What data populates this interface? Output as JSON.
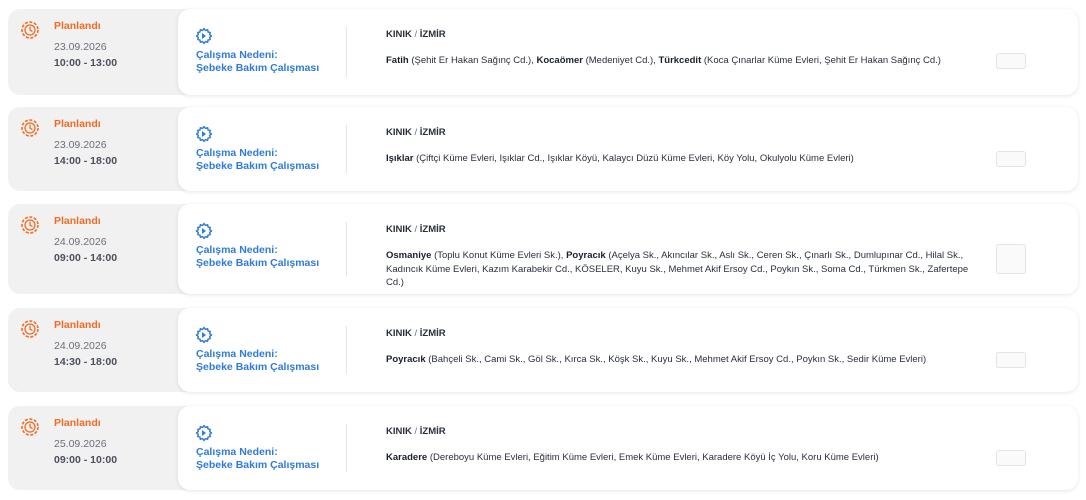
{
  "outages": [
    {
      "status": "Planlandı",
      "date": "23.09.2026",
      "time": "10:00 - 13:00",
      "reason_title": "Çalışma Nedeni:",
      "reason_value": "Şebeke Bakım Çalışması",
      "district": "KINIK",
      "separator": "/",
      "city": "İZMİR",
      "streets": [
        {
          "name": "Fatih",
          "detail": "(Şehit Er Hakan Sağınç Cd.)",
          "sep": ", "
        },
        {
          "name": "Kocaömer",
          "detail": "(Medeniyet Cd.)",
          "sep": ", "
        },
        {
          "name": "Türkcedit",
          "detail": "(Koca Çınarlar Küme Evleri, Şehit Er Hakan Sağınç Cd.)",
          "sep": ""
        }
      ]
    },
    {
      "status": "Planlandı",
      "date": "23.09.2026",
      "time": "14:00 - 18:00",
      "reason_title": "Çalışma Nedeni:",
      "reason_value": "Şebeke Bakım Çalışması",
      "district": "KINIK",
      "separator": "/",
      "city": "İZMİR",
      "streets": [
        {
          "name": "Işıklar",
          "detail": "(Çiftçi Küme Evleri, Işıklar Cd., Işıklar Köyü, Kalaycı Düzü Küme Evleri, Köy Yolu, Okulyolu Küme Evleri)",
          "sep": ""
        }
      ]
    },
    {
      "status": "Planlandı",
      "date": "24.09.2026",
      "time": "09:00 - 14:00",
      "reason_title": "Çalışma Nedeni:",
      "reason_value": "Şebeke Bakım Çalışması",
      "district": "KINIK",
      "separator": "/",
      "city": "İZMİR",
      "streets": [
        {
          "name": "Osmaniye",
          "detail": "(Toplu Konut Küme Evleri Sk.)",
          "sep": ", "
        },
        {
          "name": "Poyracık",
          "detail": "(Açelya Sk., Akıncılar Sk., Aslı Sk., Ceren Sk., Çınarlı Sk., Dumlupınar Cd., Hilal Sk., Kadıncık Küme Evleri, Kazım Karabekir Cd., KÖSELER, Kuyu Sk., Mehmet Akif Ersoy Cd., Poykın Sk., Soma Cd., Türkmen Sk., Zafertepe Cd.)",
          "sep": ""
        }
      ]
    },
    {
      "status": "Planlandı",
      "date": "24.09.2026",
      "time": "14:30 - 18:00",
      "reason_title": "Çalışma Nedeni:",
      "reason_value": "Şebeke Bakım Çalışması",
      "district": "KINIK",
      "separator": "/",
      "city": "İZMİR",
      "streets": [
        {
          "name": "Poyracık",
          "detail": "(Bahçeli Sk., Cami Sk., Göl Sk., Kırca Sk., Köşk Sk., Kuyu Sk., Mehmet Akif Ersoy Cd., Poykın Sk., Sedir Küme Evleri)",
          "sep": ""
        }
      ]
    },
    {
      "status": "Planlandı",
      "date": "25.09.2026",
      "time": "09:00 - 10:00",
      "reason_title": "Çalışma Nedeni:",
      "reason_value": "Şebeke Bakım Çalışması",
      "district": "KINIK",
      "separator": "/",
      "city": "İZMİR",
      "streets": [
        {
          "name": "Karadere",
          "detail": "(Dereboyu Küme Evleri, Eğitim Küme Evleri, Emek Küme Evleri, Karadere Köyü İç Yolu, Koru Küme Evleri)",
          "sep": ""
        }
      ]
    }
  ],
  "icons": {
    "status": "gear-clock-icon",
    "reason": "maintenance-gear-icon"
  },
  "colors": {
    "status": "#f26b21",
    "reason": "#2f7bd8",
    "row_bg": "#f1f1f2",
    "card_bg": "#ffffff"
  }
}
